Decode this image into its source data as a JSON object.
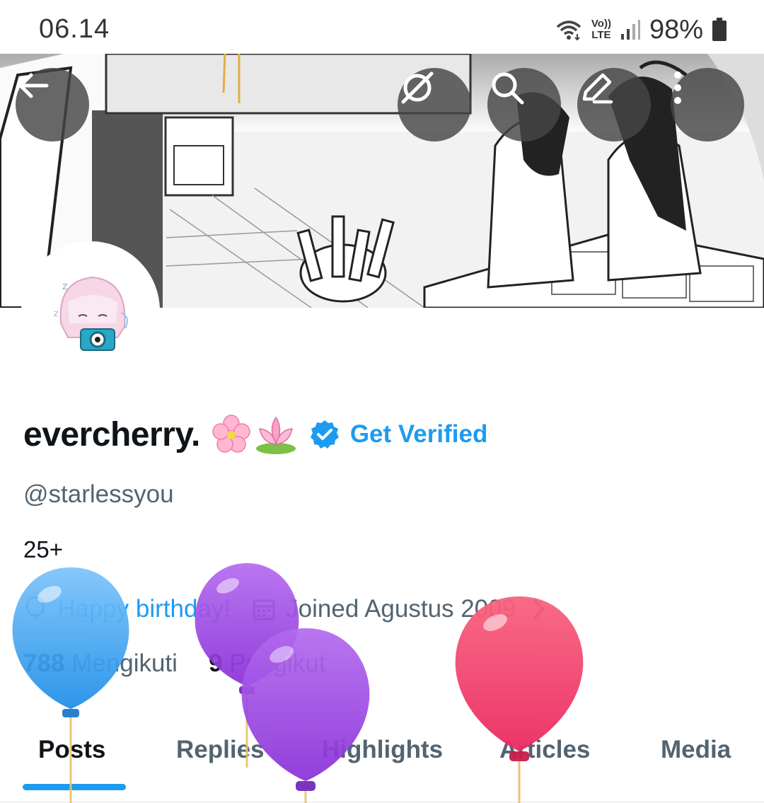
{
  "status_bar": {
    "time": "06.14",
    "battery": "98%",
    "volte_top": "Vo))",
    "volte_bottom": "LTE",
    "icons": [
      "wifi-icon",
      "volte-icon",
      "signal-icon",
      "battery-icon"
    ]
  },
  "header": {
    "buttons": [
      "back-icon",
      "grok-icon",
      "search-icon",
      "edit-icon",
      "more-icon"
    ]
  },
  "profile": {
    "display_name": "evercherry.",
    "emojis": [
      "cherry-blossom",
      "lotus"
    ],
    "get_verified_label": "Get Verified",
    "handle": "@starlessyou",
    "bio": "25+",
    "birthday_text": "Happy birthday!",
    "joined_text": "Joined Agustus 2009",
    "following_count": "788",
    "following_label": "Mengikuti",
    "followers_count": "9",
    "followers_label": "Pengikut"
  },
  "tabs": [
    {
      "label": "Posts",
      "active": true
    },
    {
      "label": "Replies",
      "active": false
    },
    {
      "label": "Highlights",
      "active": false
    },
    {
      "label": "Articles",
      "active": false
    },
    {
      "label": "Media",
      "active": false
    }
  ],
  "colors": {
    "accent": "#1d9bf0",
    "text_primary": "#0f1419",
    "text_secondary": "#536471",
    "balloon_blue": "#2e9cf0",
    "balloon_purple": "#9b3fe0",
    "balloon_pink": "#f0356a"
  }
}
